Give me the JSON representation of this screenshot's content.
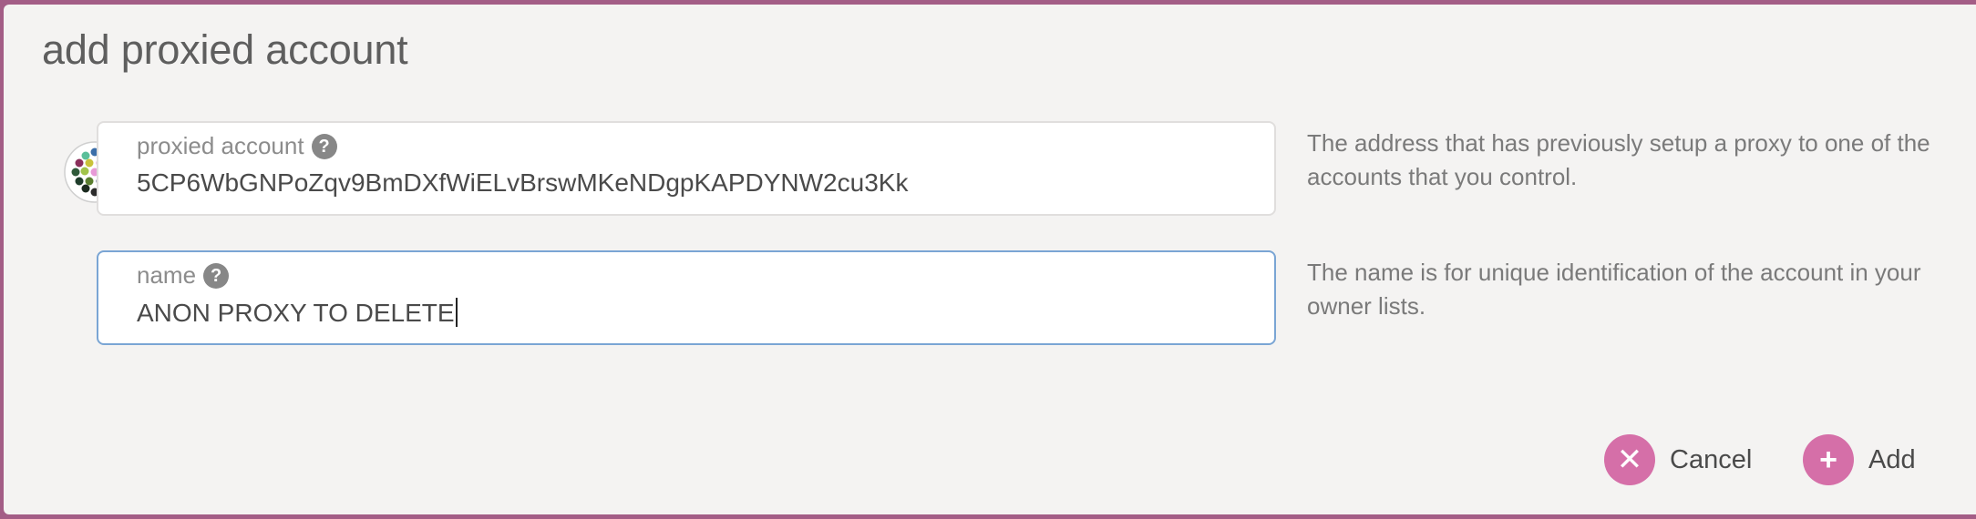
{
  "modal": {
    "title": "add proxied account"
  },
  "proxied_account": {
    "label": "proxied account",
    "value": "5CP6WbGNPoZqv9BmDXfWiELvBrswMKeNDgpKAPDYNW2cu3Kk",
    "help": "The address that has previously setup a proxy to one of the accounts that you control."
  },
  "name_field": {
    "label": "name",
    "value": "ANON PROXY TO DELETE",
    "help": "The name is for unique identification of the account in your owner lists."
  },
  "buttons": {
    "cancel": "Cancel",
    "add": "Add"
  },
  "colors": {
    "accent": "#d56fa8",
    "backdrop": "#a35d86",
    "focus_border": "#7aa5d4"
  }
}
